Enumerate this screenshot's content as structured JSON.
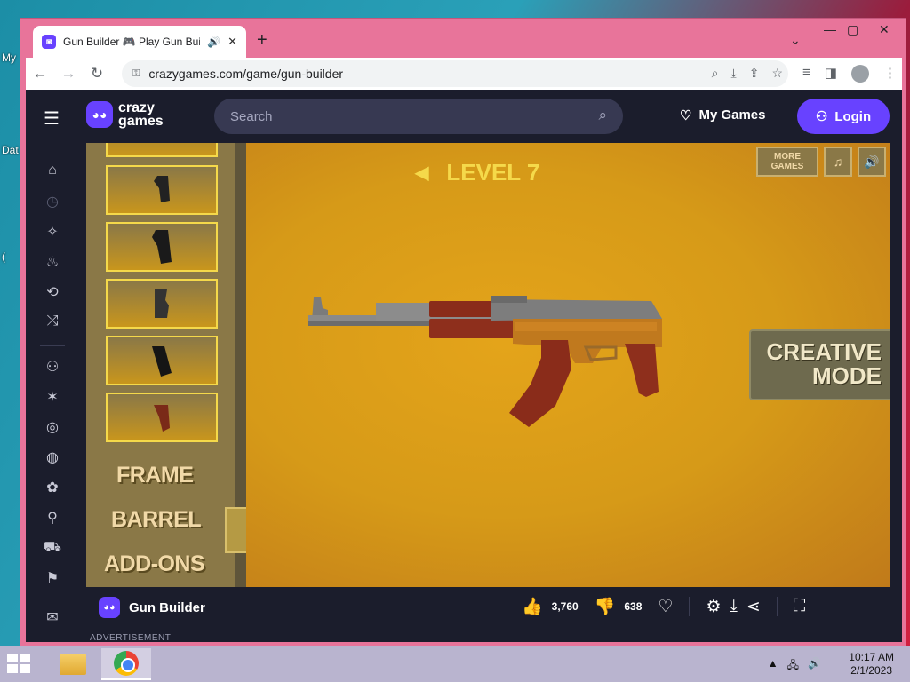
{
  "desktop": {
    "icon_labels": [
      "My",
      "Dat",
      "("
    ]
  },
  "browser": {
    "tab": {
      "title": "Gun Builder 🎮 Play Gun Builder",
      "favicon": "cg"
    },
    "url": "crazygames.com/game/gun-builder"
  },
  "site": {
    "logo_line1": "crazy",
    "logo_line2": "games",
    "search_placeholder": "Search",
    "my_games": "My Games",
    "login": "Login"
  },
  "game": {
    "level": "LEVEL 7",
    "more_games": "MORE GAMES",
    "categories": [
      "FRAME",
      "BARREL",
      "ADD-ONS"
    ],
    "creative_mode_line1": "CREATIVE",
    "creative_mode_line2": "MODE"
  },
  "game_footer": {
    "name": "Gun Builder",
    "likes": "3,760",
    "dislikes": "638"
  },
  "advertisement": "ADVERTISEMENT",
  "taskbar": {
    "time": "10:17 AM",
    "date": "2/1/2023"
  },
  "colors": {
    "brand": "#6842ff",
    "header_bg": "#1b1d2c",
    "game_bg": "#d69a18",
    "level_text": "#f5d94a",
    "window_frame": "#e8749a"
  }
}
